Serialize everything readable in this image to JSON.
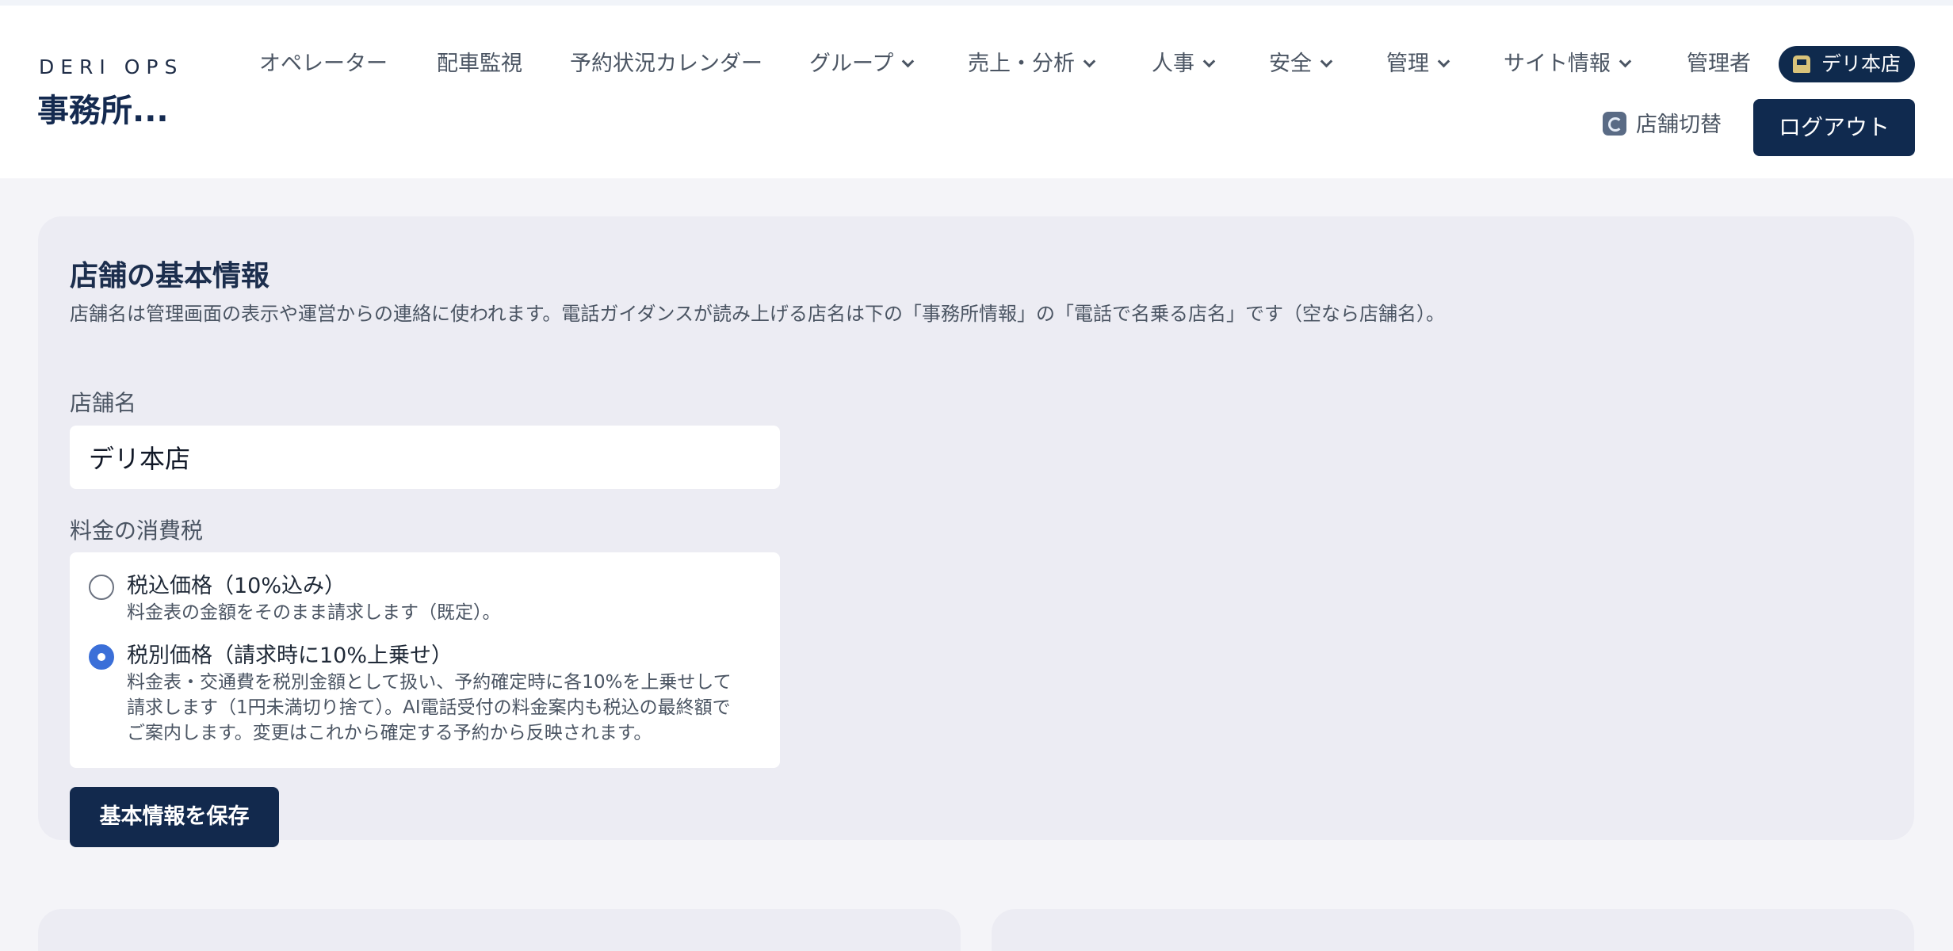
{
  "brand": {
    "kicker": "DERI OPS",
    "title": "事務所..."
  },
  "nav": {
    "items": [
      {
        "label": "オペレーター"
      },
      {
        "label": "配車監視"
      },
      {
        "label": "予約状況カレンダー"
      },
      {
        "label": "グループ"
      },
      {
        "label": "売上・分析"
      },
      {
        "label": "人事"
      },
      {
        "label": "安全"
      },
      {
        "label": "管理"
      },
      {
        "label": "サイト情報"
      },
      {
        "label": "管理者"
      }
    ],
    "store_badge": "デリ本店",
    "switch_label": "店舗切替",
    "logout_label": "ログアウト"
  },
  "basic_info": {
    "title": "店舗の基本情報",
    "description": "店舗名は管理画面の表示や運営からの連絡に使われます。電話ガイダンスが読み上げる店名は下の「事務所情報」の「電話で名乗る店名」です（空なら店舗名）。",
    "name_label": "店舗名",
    "name_value": "デリ本店",
    "tax_label": "料金の消費税",
    "tax_options": [
      {
        "title": "税込価格（10%込み）",
        "desc": [
          "料金表の金額をそのまま請求します（既定）。"
        ],
        "selected": false
      },
      {
        "title": "税別価格（請求時に10%上乗せ）",
        "desc": [
          "料金表・交通費を税別金額として扱い、予約確定時に各10%を上乗せして",
          "請求します（1円未満切り捨て）。AI電話受付の料金案内も税込の最終額で",
          "ご案内します。変更はこれから確定する予約から反映されます。"
        ],
        "selected": true
      }
    ],
    "save_label": "基本情報を保存"
  },
  "colors": {
    "accent": "#102a4f",
    "radio_selected": "#3b6fd8",
    "background": "#f4f4f8",
    "card": "#ececf3"
  }
}
